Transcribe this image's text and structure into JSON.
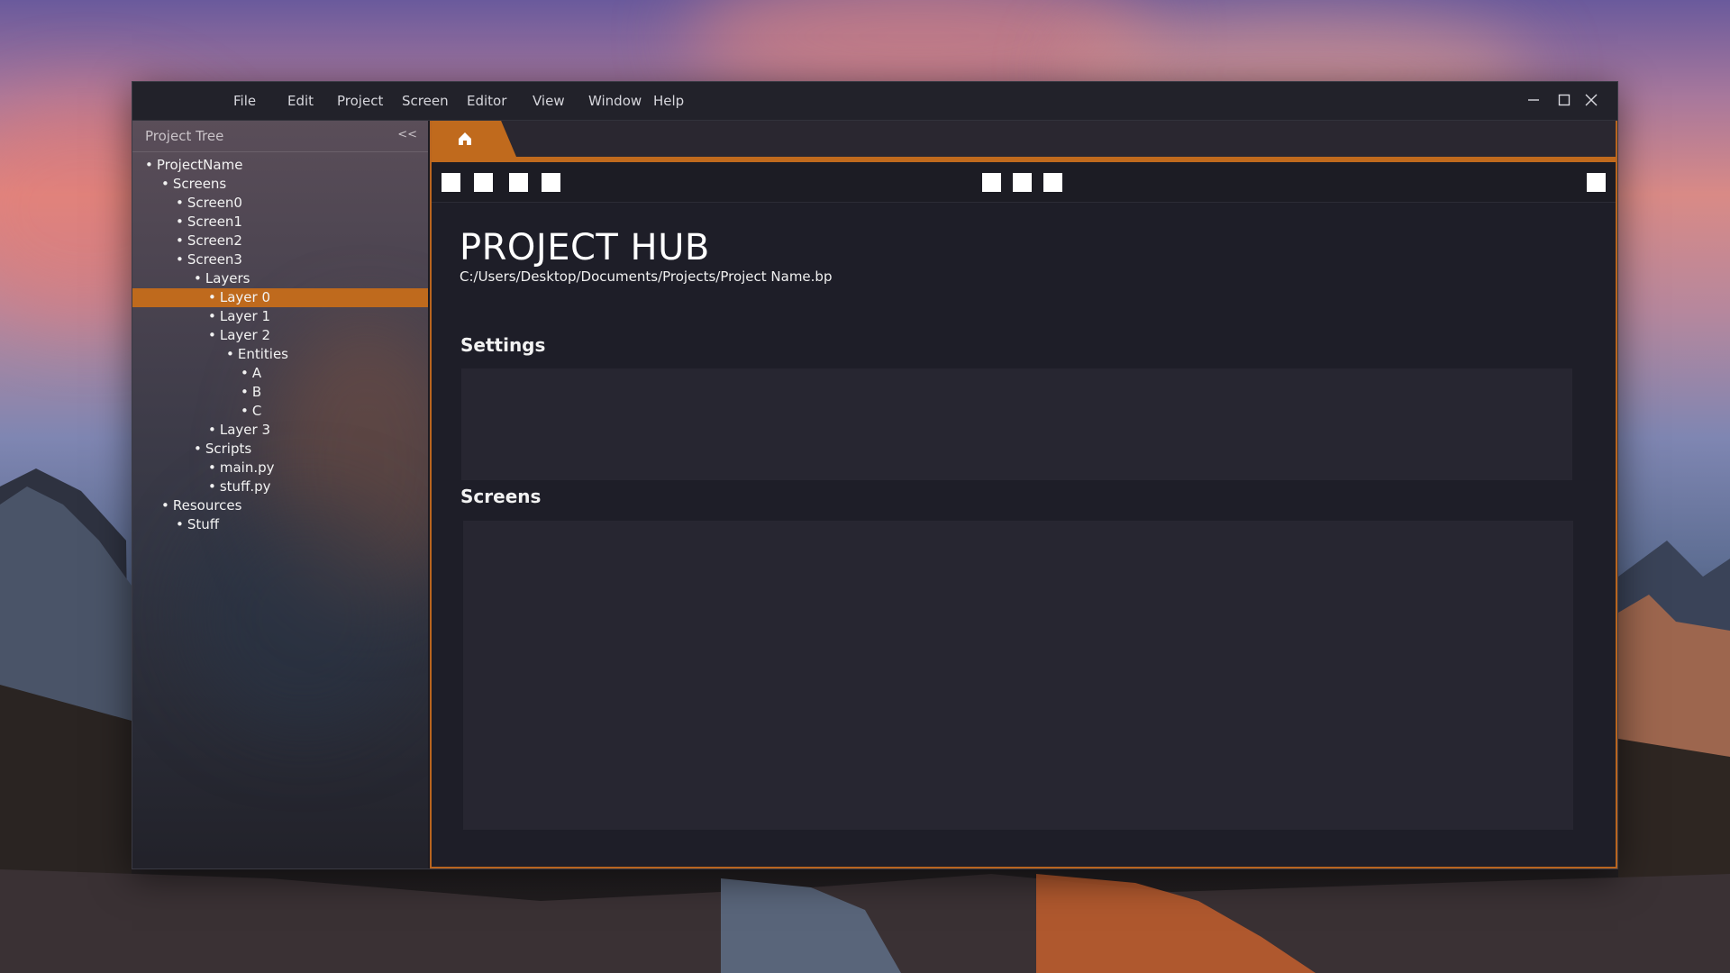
{
  "menu": {
    "items": [
      "File",
      "Edit",
      "Project",
      "Screen",
      "Editor",
      "View",
      "Window",
      "Help"
    ]
  },
  "window_controls": {
    "minimize": "minimize-icon",
    "maximize": "maximize-icon",
    "close": "close-icon"
  },
  "sidebar": {
    "title": "Project Tree",
    "collapse_label": "<<",
    "tree": [
      {
        "label": "ProjectName",
        "depth": 0
      },
      {
        "label": "Screens",
        "depth": 1
      },
      {
        "label": "Screen0",
        "depth": 2
      },
      {
        "label": "Screen1",
        "depth": 2
      },
      {
        "label": "Screen2",
        "depth": 2
      },
      {
        "label": "Screen3",
        "depth": 2
      },
      {
        "label": "Layers",
        "depth": 3
      },
      {
        "label": "Layer 0",
        "depth": 4,
        "selected": true
      },
      {
        "label": "Layer 1",
        "depth": 4
      },
      {
        "label": "Layer 2",
        "depth": 4
      },
      {
        "label": "Entities",
        "depth": 5
      },
      {
        "label": "A",
        "depth": 6
      },
      {
        "label": "B",
        "depth": 6
      },
      {
        "label": "C",
        "depth": 6
      },
      {
        "label": "Layer 3",
        "depth": 4
      },
      {
        "label": "Scripts",
        "depth": 3
      },
      {
        "label": "main.py",
        "depth": 4
      },
      {
        "label": "stuff.py",
        "depth": 4
      },
      {
        "label": "Resources",
        "depth": 1
      },
      {
        "label": "Stuff",
        "depth": 2
      }
    ]
  },
  "tabs": {
    "home_icon": "home-icon"
  },
  "main": {
    "title": "PROJECT HUB",
    "path": "C:/Users/Desktop/Documents/Projects/Project Name.bp",
    "settings_label": "Settings",
    "screens_label": "Screens"
  },
  "colors": {
    "accent": "#c06a1d",
    "window_bg": "#1e1e28",
    "panel_bg": "#272631"
  }
}
